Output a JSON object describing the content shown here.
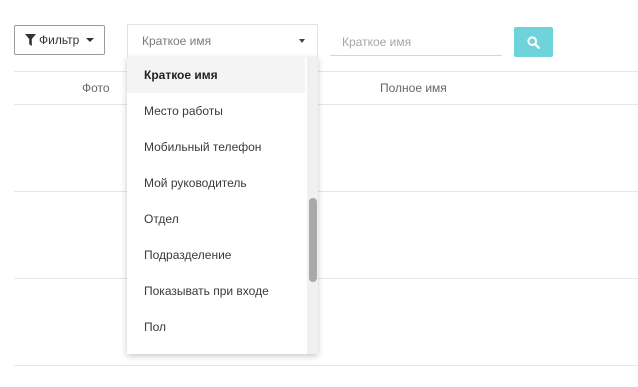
{
  "toolbar": {
    "filter_label": "Фильтр",
    "field_select_value": "Краткое имя",
    "search_placeholder": "Краткое имя"
  },
  "table": {
    "columns": [
      "Фото",
      "Полное имя"
    ]
  },
  "dropdown": {
    "items": [
      "Краткое имя",
      "Место работы",
      "Мобильный телефон",
      "Мой руководитель",
      "Отдел",
      "Подразделение",
      "Показывать при входе",
      "Пол"
    ],
    "selected_index": 0
  },
  "colors": {
    "search_button": "#6fd3db"
  }
}
